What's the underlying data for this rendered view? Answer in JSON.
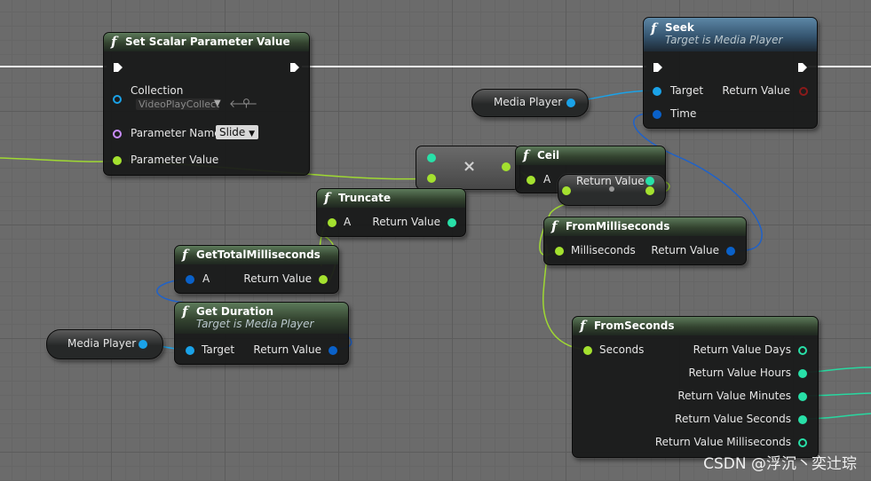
{
  "colors": {
    "float": "#a4e12f",
    "object": "#1aa2e8",
    "struct": "#0a61c9",
    "int": "#28e0a8",
    "name": "#c98cff",
    "exec": "#ffffff",
    "wire_float": "#9fd932"
  },
  "nodes": {
    "set_scalar": {
      "title": "Set Scalar Parameter Value",
      "collection_label": "Collection",
      "collection_value": "VideoPlayCollect",
      "param_name_label": "Parameter Name",
      "param_name_value": "Slide",
      "param_value_label": "Parameter Value"
    },
    "seek": {
      "title": "Seek",
      "subtitle": "Target is Media Player",
      "target_label": "Target",
      "time_label": "Time",
      "return_label": "Return Value"
    },
    "media_player_top": {
      "label": "Media  Player"
    },
    "media_player_bottom": {
      "label": "Media  Player"
    },
    "multiply": {
      "symbol": "×"
    },
    "ceil": {
      "title": "Ceil",
      "a_label": "A",
      "return_label": "Return Value"
    },
    "truncate": {
      "title": "Truncate",
      "a_label": "A",
      "return_label": "Return Value"
    },
    "from_ms": {
      "title": "FromMilliseconds",
      "ms_label": "Milliseconds",
      "return_label": "Return Value"
    },
    "get_total_ms": {
      "title": "GetTotalMilliseconds",
      "a_label": "A",
      "return_label": "Return Value"
    },
    "get_duration": {
      "title": "Get Duration",
      "subtitle": "Target is Media Player",
      "target_label": "Target",
      "return_label": "Return Value"
    },
    "from_seconds": {
      "title": "FromSeconds",
      "seconds_label": "Seconds",
      "outputs": [
        "Return Value Days",
        "Return Value Hours",
        "Return Value Minutes",
        "Return Value Seconds",
        "Return Value Milliseconds"
      ]
    }
  },
  "watermark": "CSDN @浮沉丶奕辻琮"
}
